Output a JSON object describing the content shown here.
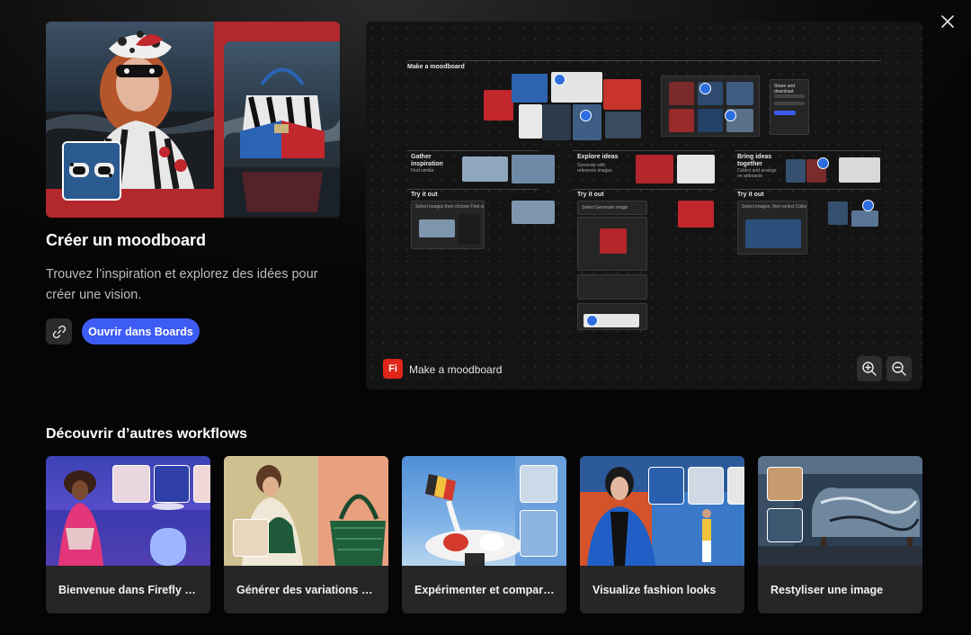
{
  "hero": {
    "title": "Créer un moodboard",
    "description": "Trouvez l’inspiration et explorez des idées pour créer une vision.",
    "open_button": "Ouvrir dans Boards"
  },
  "preview": {
    "board_title": "Make a moodboard",
    "share_panel_title": "Share and download",
    "steps": [
      {
        "title": "Gather inspiration",
        "subtitle": "Find similar"
      },
      {
        "title": "Explore ideas",
        "subtitle": "Generate with reference images"
      },
      {
        "title": "Bring ideas together",
        "subtitle": "Collect and arrange on artboards"
      }
    ],
    "try_label": "Try it out",
    "try_hints": [
      "Select images then choose Find similar inspiration",
      "Select Generate image",
      "Select images, then select Collect ideas"
    ],
    "app_badge": "Fi",
    "footer_label": "Make a moodboard"
  },
  "discover": {
    "title": "Découvrir d’autres workflows",
    "cards": [
      {
        "label": "Bienvenue dans Firefly Boards"
      },
      {
        "label": "Générer des variations de produits"
      },
      {
        "label": "Expérimenter et comparer des modèles"
      },
      {
        "label": "Visualize fashion looks"
      },
      {
        "label": "Restyliser une image"
      }
    ]
  },
  "colors": {
    "accent": "#3d5cf5",
    "app_icon": "#e0251b",
    "hero_bg": "#b2282d"
  },
  "icons": [
    "close-icon",
    "link-icon",
    "zoom-in-icon",
    "zoom-out-icon",
    "firefly-app-icon"
  ]
}
